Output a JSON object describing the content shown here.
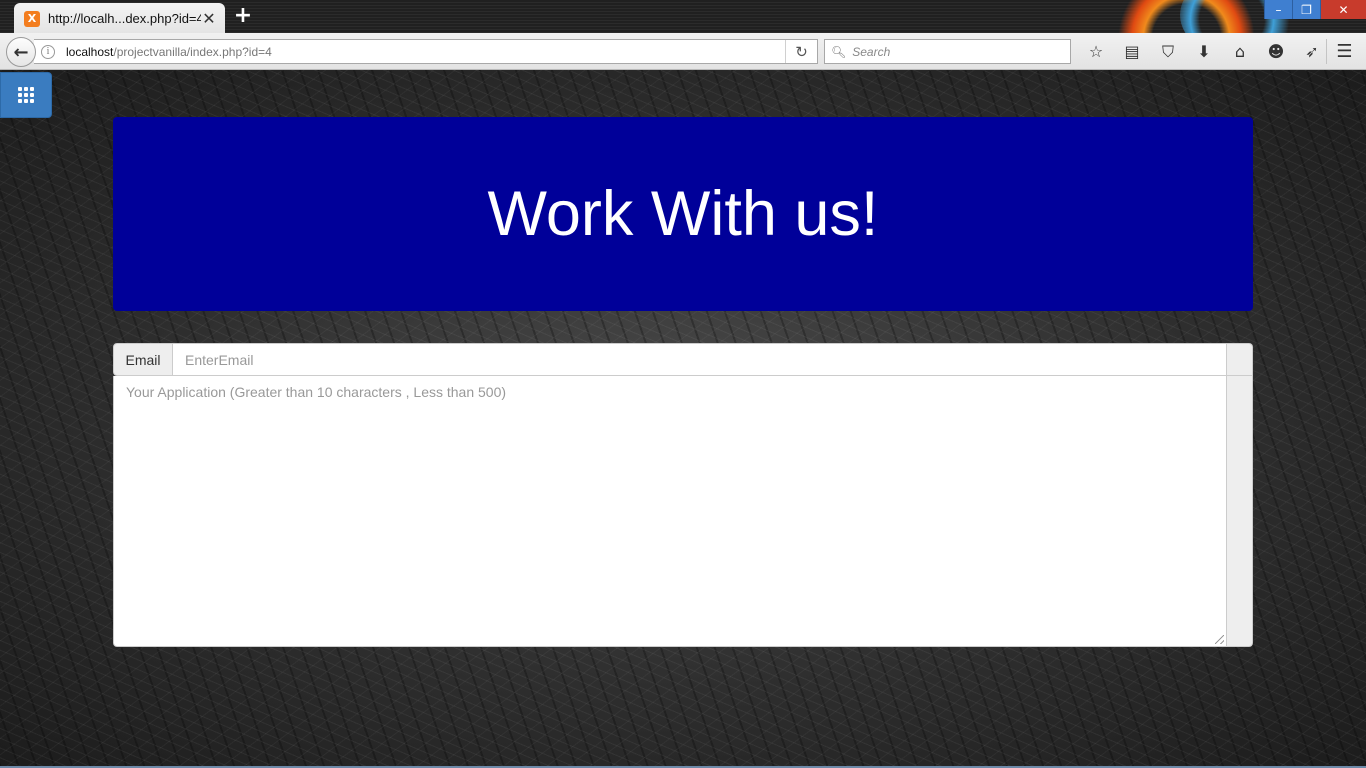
{
  "browser": {
    "tab_title": "http://localh...dex.php?id=4",
    "tab_favicon": "X",
    "tab_close": "✕",
    "new_tab": "+",
    "url_host": "localhost",
    "url_path": "/projectvanilla/index.php?id=4",
    "search_placeholder": "Search",
    "window_controls": {
      "minimize": "–",
      "restore": "❐",
      "close": "✕"
    },
    "toolbar_icons": [
      "bookmark-star-icon",
      "reading-list-icon",
      "pocket-icon",
      "download-icon",
      "home-icon",
      "smiley-icon",
      "send-icon"
    ]
  },
  "page": {
    "heading": "Work With us!",
    "email_label": "Email",
    "email_placeholder": "EnterEmail",
    "application_placeholder": "Your Application (Greater than 10 characters , Less than 500)"
  },
  "colors": {
    "jumbotron_bg": "#000099",
    "apps_button_bg": "#3a7cc0",
    "heading_text": "#ffffff"
  }
}
